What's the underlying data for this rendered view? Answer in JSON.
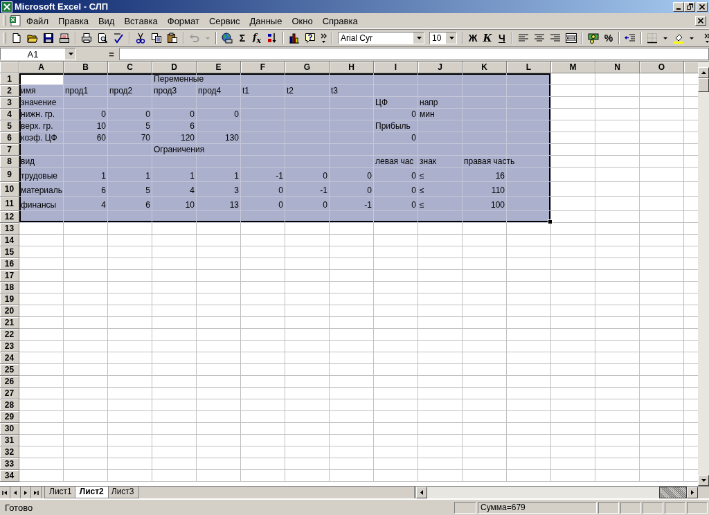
{
  "window": {
    "title": "Microsoft Excel - СЛП"
  },
  "menu": [
    "Файл",
    "Правка",
    "Вид",
    "Вставка",
    "Формат",
    "Сервис",
    "Данные",
    "Окно",
    "Справка"
  ],
  "toolbar": {
    "undo": {
      "disabled": true
    },
    "sum": "Σ",
    "function": "f$_{x}$",
    "font": "Arial Cyr",
    "size": "10",
    "bold": "Ж",
    "italic": "К",
    "underline": "Ч",
    "percent": "%"
  },
  "formula_bar": {
    "name_box": "A1",
    "equals": "="
  },
  "columns": [
    {
      "label": "A",
      "selected": true
    },
    {
      "label": "B",
      "selected": true
    },
    {
      "label": "C",
      "selected": true
    },
    {
      "label": "D",
      "selected": true
    },
    {
      "label": "E",
      "selected": true
    },
    {
      "label": "F",
      "selected": true
    },
    {
      "label": "G",
      "selected": true
    },
    {
      "label": "H",
      "selected": true
    },
    {
      "label": "I",
      "selected": true
    },
    {
      "label": "J",
      "selected": true
    },
    {
      "label": "K",
      "selected": true
    },
    {
      "label": "L",
      "selected": true
    },
    {
      "label": "M",
      "selected": false
    },
    {
      "label": "N",
      "selected": false
    },
    {
      "label": "O",
      "selected": false
    }
  ],
  "rows": [
    {
      "header": "1",
      "selected": true,
      "kind": "normal",
      "cells": [
        {
          "active": true
        },
        null,
        null,
        {
          "text": "Переменные",
          "kind": "text"
        }
      ]
    },
    {
      "header": "2",
      "selected": true,
      "kind": "normal",
      "cells": [
        {
          "text": "имя",
          "kind": "text"
        },
        {
          "text": "прод1",
          "kind": "text"
        },
        {
          "text": "прод2",
          "kind": "text"
        },
        {
          "text": "прод3",
          "kind": "text"
        },
        {
          "text": "прод4",
          "kind": "text"
        },
        {
          "text": "t1",
          "kind": "text"
        },
        {
          "text": "t2",
          "kind": "text"
        },
        {
          "text": "t3",
          "kind": "text"
        }
      ]
    },
    {
      "header": "3",
      "selected": true,
      "kind": "normal",
      "cells": [
        {
          "text": "значение",
          "kind": "text"
        },
        null,
        null,
        null,
        null,
        null,
        null,
        null,
        {
          "text": "ЦФ",
          "kind": "text"
        },
        {
          "text": "напр",
          "kind": "text"
        }
      ]
    },
    {
      "header": "4",
      "selected": true,
      "kind": "normal",
      "cells": [
        {
          "text": "нижн. гр.",
          "kind": "text"
        },
        {
          "text": "0",
          "kind": "number"
        },
        {
          "text": "0",
          "kind": "number"
        },
        {
          "text": "0",
          "kind": "number"
        },
        {
          "text": "0",
          "kind": "number"
        },
        null,
        null,
        null,
        {
          "text": "0",
          "kind": "number"
        },
        {
          "text": "мин",
          "kind": "text"
        }
      ]
    },
    {
      "header": "5",
      "selected": true,
      "kind": "normal",
      "cells": [
        {
          "text": "верх. гр.",
          "kind": "text"
        },
        {
          "text": "10",
          "kind": "number"
        },
        {
          "text": "5",
          "kind": "number"
        },
        {
          "text": "6",
          "kind": "number"
        },
        null,
        null,
        null,
        null,
        {
          "text": "Прибыль",
          "kind": "text"
        }
      ]
    },
    {
      "header": "6",
      "selected": true,
      "kind": "normal",
      "cells": [
        {
          "text": "коэф. ЦФ",
          "kind": "text"
        },
        {
          "text": "60",
          "kind": "number"
        },
        {
          "text": "70",
          "kind": "number"
        },
        {
          "text": "120",
          "kind": "number"
        },
        {
          "text": "130",
          "kind": "number"
        },
        null,
        null,
        null,
        {
          "text": "0",
          "kind": "number"
        }
      ]
    },
    {
      "header": "7",
      "selected": true,
      "kind": "normal",
      "cells": [
        null,
        null,
        null,
        {
          "text": "Ограничения",
          "kind": "text"
        }
      ]
    },
    {
      "header": "8",
      "selected": true,
      "kind": "normal",
      "cells": [
        {
          "text": "вид",
          "kind": "text"
        },
        null,
        null,
        null,
        null,
        null,
        null,
        null,
        {
          "text": "левая час",
          "kind": "text"
        },
        {
          "text": "знак",
          "kind": "text"
        },
        {
          "text": "правая часть",
          "kind": "text"
        }
      ]
    },
    {
      "header": "9",
      "selected": true,
      "kind": "tall",
      "cells": [
        {
          "text": "трудовые",
          "kind": "text"
        },
        {
          "text": "1",
          "kind": "number"
        },
        {
          "text": "1",
          "kind": "number"
        },
        {
          "text": "1",
          "kind": "number"
        },
        {
          "text": "1",
          "kind": "number"
        },
        {
          "text": "-1",
          "kind": "number"
        },
        {
          "text": "0",
          "kind": "number"
        },
        {
          "text": "0",
          "kind": "number"
        },
        {
          "text": "0",
          "kind": "number"
        },
        {
          "text": "≤",
          "kind": "text"
        },
        {
          "text": "16",
          "kind": "number"
        }
      ]
    },
    {
      "header": "10",
      "selected": true,
      "kind": "tall",
      "cells": [
        {
          "text": "материаль",
          "kind": "text"
        },
        {
          "text": "6",
          "kind": "number"
        },
        {
          "text": "5",
          "kind": "number"
        },
        {
          "text": "4",
          "kind": "number"
        },
        {
          "text": "3",
          "kind": "number"
        },
        {
          "text": "0",
          "kind": "number"
        },
        {
          "text": "-1",
          "kind": "number"
        },
        {
          "text": "0",
          "kind": "number"
        },
        {
          "text": "0",
          "kind": "number"
        },
        {
          "text": "≤",
          "kind": "text"
        },
        {
          "text": "110",
          "kind": "number"
        }
      ]
    },
    {
      "header": "11",
      "selected": true,
      "kind": "tall",
      "cells": [
        {
          "text": "финансы",
          "kind": "text"
        },
        {
          "text": "4",
          "kind": "number"
        },
        {
          "text": "6",
          "kind": "number"
        },
        {
          "text": "10",
          "kind": "number"
        },
        {
          "text": "13",
          "kind": "number"
        },
        {
          "text": "0",
          "kind": "number"
        },
        {
          "text": "0",
          "kind": "number"
        },
        {
          "text": "-1",
          "kind": "number"
        },
        {
          "text": "0",
          "kind": "number"
        },
        {
          "text": "≤",
          "kind": "text"
        },
        {
          "text": "100",
          "kind": "number"
        }
      ]
    },
    {
      "header": "12",
      "selected": true,
      "kind": "normal"
    },
    {
      "header": "13",
      "selected": false,
      "kind": "normal"
    },
    {
      "header": "14",
      "selected": false,
      "kind": "normal"
    },
    {
      "header": "15",
      "selected": false,
      "kind": "normal"
    },
    {
      "header": "16",
      "selected": false,
      "kind": "normal"
    },
    {
      "header": "17",
      "selected": false,
      "kind": "normal"
    },
    {
      "header": "18",
      "selected": false,
      "kind": "normal"
    },
    {
      "header": "19",
      "selected": false,
      "kind": "normal"
    },
    {
      "header": "20",
      "selected": false,
      "kind": "normal"
    },
    {
      "header": "21",
      "selected": false,
      "kind": "normal"
    },
    {
      "header": "22",
      "selected": false,
      "kind": "normal"
    },
    {
      "header": "23",
      "selected": false,
      "kind": "normal"
    },
    {
      "header": "24",
      "selected": false,
      "kind": "normal"
    },
    {
      "header": "25",
      "selected": false,
      "kind": "normal"
    },
    {
      "header": "26",
      "selected": false,
      "kind": "normal"
    },
    {
      "header": "27",
      "selected": false,
      "kind": "normal"
    },
    {
      "header": "28",
      "selected": false,
      "kind": "normal"
    },
    {
      "header": "29",
      "selected": false,
      "kind": "normal"
    },
    {
      "header": "30",
      "selected": false,
      "kind": "normal"
    },
    {
      "header": "31",
      "selected": false,
      "kind": "normal"
    },
    {
      "header": "32",
      "selected": false,
      "kind": "normal"
    },
    {
      "header": "33",
      "selected": false,
      "kind": "normal"
    },
    {
      "header": "34",
      "selected": false,
      "kind": "normal"
    }
  ],
  "sheet_tabs": [
    {
      "label": "Лист1",
      "selected": false
    },
    {
      "label": "Лист2",
      "selected": true
    },
    {
      "label": "Лист3",
      "selected": false
    }
  ],
  "status_bar": {
    "mode": "Готово",
    "sum": "Сумма=679"
  }
}
